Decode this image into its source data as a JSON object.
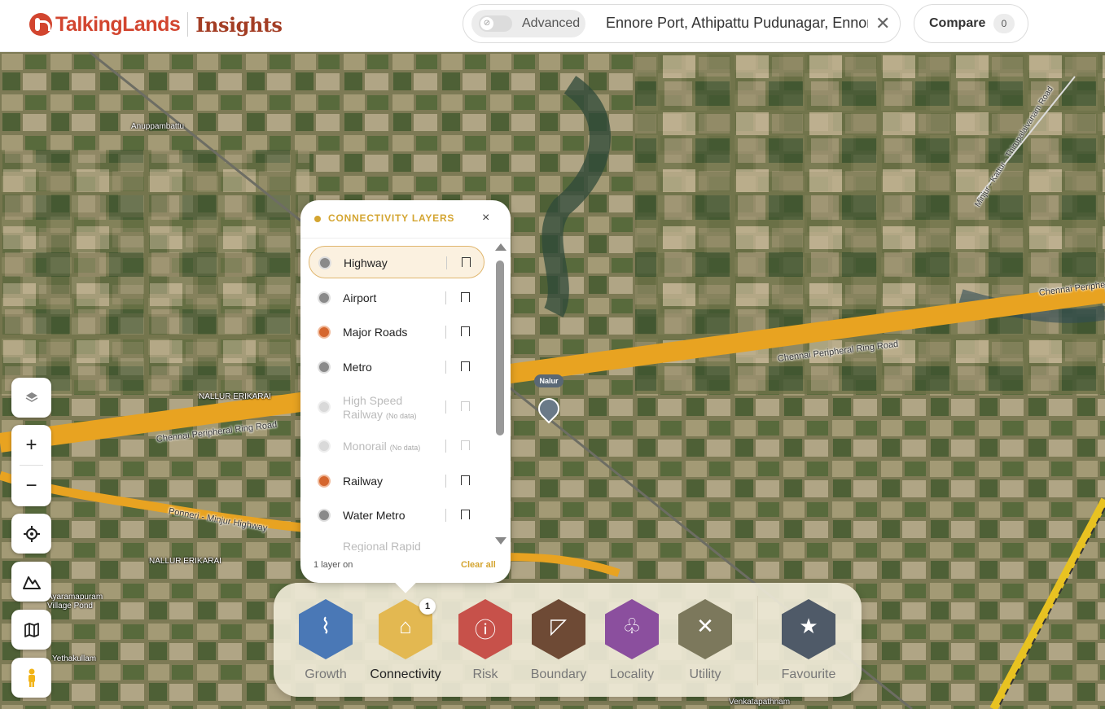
{
  "header": {
    "brand": "TalkingLands",
    "product": "Insights",
    "advanced_label": "Advanced",
    "search_value": "Ennore Port, Athipattu Pudunagar, Ennore",
    "compare_label": "Compare",
    "compare_count": "0"
  },
  "map": {
    "places": [
      "Anuppambattu",
      "NALLUR ERIKARAI",
      "NALLUR ERIKARAI",
      "Ayaramapuram Village Pond",
      "Yethakullam",
      "Venkatapathnam"
    ],
    "roads": [
      "Chennai Peripheral Ring Road",
      "Chennai Peripheral Ring Road",
      "Chennai Peripher",
      "Ponneri - Minjur Highway",
      "Minjur - Kattur - Thirupalaivanam Road"
    ],
    "pin_label": "Nalur"
  },
  "controls": {
    "layers_icon": "layers-icon",
    "zoom_in": "+",
    "zoom_out": "−"
  },
  "panel": {
    "title": "CONNECTIVITY LAYERS",
    "close": "×",
    "items": [
      {
        "label": "Highway",
        "active": true
      },
      {
        "label": "Airport"
      },
      {
        "label": "Major Roads"
      },
      {
        "label": "Metro"
      },
      {
        "label": "High Speed Railway",
        "no_data": "(No data)"
      },
      {
        "label": "Monorail",
        "no_data": "(No data)"
      },
      {
        "label": "Railway"
      },
      {
        "label": "Water Metro"
      },
      {
        "label": "Regional Rapid"
      }
    ],
    "footer_status": "1 layer on",
    "clear_label": "Clear all"
  },
  "dock": {
    "items": [
      {
        "label": "Growth",
        "color": "#4a78b6",
        "icon": "growth-icon"
      },
      {
        "label": "Connectivity",
        "color": "#e3b851",
        "icon": "train-icon",
        "badge": "1"
      },
      {
        "label": "Risk",
        "color": "#c7514a",
        "icon": "alert-icon"
      },
      {
        "label": "Boundary",
        "color": "#6e4a35",
        "icon": "boundary-icon"
      },
      {
        "label": "Locality",
        "color": "#8b4f9e",
        "icon": "locality-icon"
      },
      {
        "label": "Utility",
        "color": "#7c785c",
        "icon": "tools-icon"
      },
      {
        "label": "Favourite",
        "color": "#4f5a68",
        "icon": "star-icon"
      }
    ]
  }
}
